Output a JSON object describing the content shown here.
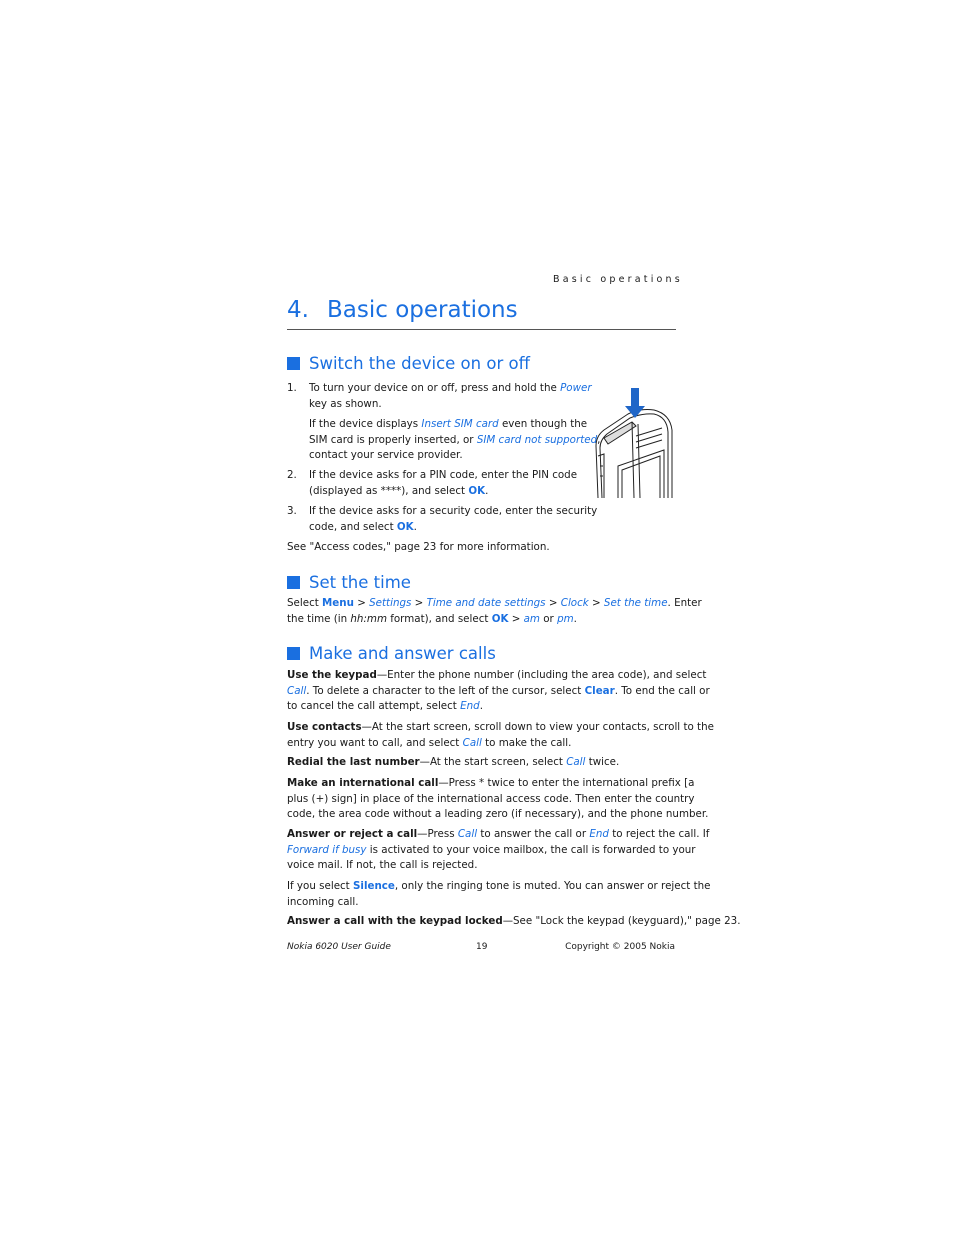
{
  "running_header": "Basic operations",
  "chapter": {
    "number": "4.",
    "title": "Basic operations"
  },
  "accent_color": "#1a6fe0",
  "image": {
    "icon": "phone-power-key-illustration"
  },
  "sections": [
    {
      "heading": "Switch the device on or off",
      "blocks": [
        {
          "num": "1.",
          "lines": [
            [
              [
                "To turn your device on or off, press and hold the ",
                "n"
              ],
              [
                "Power",
                "i"
              ]
            ],
            [
              [
                "key as shown.",
                "n"
              ]
            ]
          ]
        },
        {
          "num": "",
          "lines": [
            [
              [
                "If the device displays ",
                "n"
              ],
              [
                "Insert SIM card",
                "i"
              ],
              [
                " even though the",
                "n"
              ]
            ],
            [
              [
                "SIM card is properly inserted, or ",
                "n"
              ],
              [
                "SIM card not supported",
                "i"
              ],
              [
                ",",
                "n"
              ]
            ],
            [
              [
                "contact your service provider.",
                "n"
              ]
            ]
          ]
        },
        {
          "num": "2.",
          "lines": [
            [
              [
                "If the device asks for a PIN code, enter the PIN code",
                "n"
              ]
            ],
            [
              [
                "(displayed as ****), and select ",
                "n"
              ],
              [
                "OK",
                "k"
              ],
              [
                ".",
                "n"
              ]
            ]
          ]
        },
        {
          "num": "3.",
          "lines": [
            [
              [
                "If the device asks for a security code, enter the security",
                "n"
              ]
            ],
            [
              [
                "code, and select ",
                "n"
              ],
              [
                "OK",
                "k"
              ],
              [
                ".",
                "n"
              ]
            ]
          ]
        },
        {
          "lines": [
            [
              [
                "See \"Access codes,\" page 23 for more information.",
                "n"
              ]
            ]
          ]
        }
      ]
    },
    {
      "heading": "Set the time",
      "blocks": [
        {
          "lines": [
            [
              [
                "Select ",
                "n"
              ],
              [
                "Menu",
                "k"
              ],
              [
                " > ",
                "n"
              ],
              [
                "Settings",
                "i"
              ],
              [
                " > ",
                "n"
              ],
              [
                "Time and date settings",
                "i"
              ],
              [
                " > ",
                "n"
              ],
              [
                "Clock",
                "i"
              ],
              [
                " > ",
                "n"
              ],
              [
                "Set the time",
                "i"
              ],
              [
                ". Enter",
                "n"
              ]
            ],
            [
              [
                "the time (in ",
                "n"
              ],
              [
                "hh:mm",
                "e"
              ],
              [
                " format), and select ",
                "n"
              ],
              [
                "OK",
                "k"
              ],
              [
                " > ",
                "n"
              ],
              [
                "am",
                "i"
              ],
              [
                " or ",
                "n"
              ],
              [
                "pm",
                "i"
              ],
              [
                ".",
                "n"
              ]
            ]
          ]
        }
      ]
    },
    {
      "heading": "Make and answer calls",
      "blocks": [
        {
          "lines": [
            [
              [
                "Use the keypad",
                "b"
              ],
              [
                "—Enter the phone number (including the area code), and select",
                "n"
              ]
            ],
            [
              [
                "Call",
                "i"
              ],
              [
                ". To delete a character to the left of the cursor, select ",
                "n"
              ],
              [
                "Clear",
                "k"
              ],
              [
                ". To end the call or",
                "n"
              ]
            ],
            [
              [
                "to cancel the call attempt, select ",
                "n"
              ],
              [
                "End",
                "i"
              ],
              [
                ".",
                "n"
              ]
            ]
          ]
        },
        {
          "lines": [
            [
              [
                "Use contacts",
                "b"
              ],
              [
                "—At the start screen, scroll down to view your contacts, scroll to the",
                "n"
              ]
            ],
            [
              [
                "entry you want to call, and select ",
                "n"
              ],
              [
                "Call",
                "i"
              ],
              [
                " to make the call.",
                "n"
              ]
            ]
          ]
        },
        {
          "lines": [
            [
              [
                "Redial the last number",
                "b"
              ],
              [
                "—At the start screen, select ",
                "n"
              ],
              [
                "Call",
                "i"
              ],
              [
                " twice.",
                "n"
              ]
            ]
          ]
        },
        {
          "lines": [
            [
              [
                "Make an international call",
                "b"
              ],
              [
                "—Press * twice to enter the international prefix [a",
                "n"
              ]
            ],
            [
              [
                "plus (+) sign] in place of the international access code. Then enter the country",
                "n"
              ]
            ],
            [
              [
                "code, the area code without a leading zero (if necessary), and the phone number.",
                "n"
              ]
            ]
          ]
        },
        {
          "lines": [
            [
              [
                "Answer or reject a call",
                "b"
              ],
              [
                "—Press ",
                "n"
              ],
              [
                "Call",
                "i"
              ],
              [
                "  to answer the call or ",
                "n"
              ],
              [
                "End",
                "i"
              ],
              [
                " to reject the call. If",
                "n"
              ]
            ],
            [
              [
                "Forward if busy",
                "i"
              ],
              [
                " is activated to your voice mailbox, the call is forwarded to your",
                "n"
              ]
            ],
            [
              [
                "voice mail. If not, the call is rejected.",
                "n"
              ]
            ]
          ]
        },
        {
          "lines": [
            [
              [
                "If you select ",
                "n"
              ],
              [
                "Silence",
                "k"
              ],
              [
                ", only the ringing tone is muted. You can answer or reject the",
                "n"
              ]
            ],
            [
              [
                "incoming call.",
                "n"
              ]
            ]
          ]
        },
        {
          "lines": [
            [
              [
                "Answer a call with the keypad locked",
                "b"
              ],
              [
                "—See \"Lock the keypad (keyguard),\" page 23.",
                "n"
              ]
            ]
          ]
        }
      ]
    }
  ],
  "footer": {
    "left": "Nokia 6020 User Guide",
    "page": "19",
    "right": "Copyright © 2005 Nokia"
  }
}
